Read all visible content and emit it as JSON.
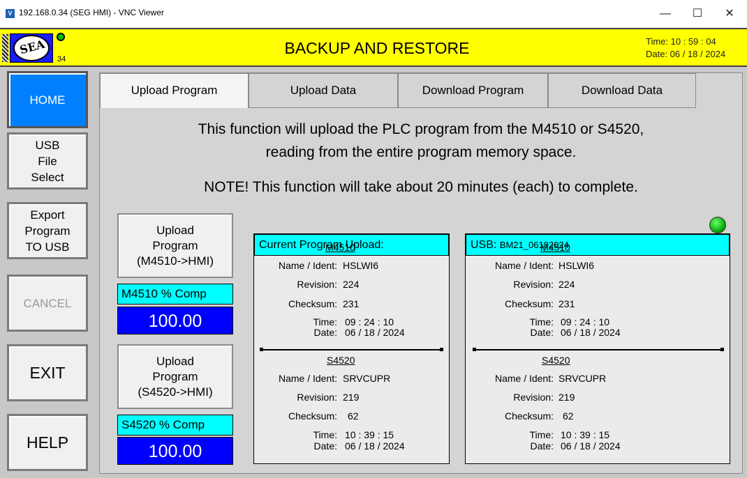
{
  "window": {
    "title": "192.168.0.34 (SEG HMI) - VNC Viewer",
    "logo_text": "V",
    "minimize": "—",
    "maximize": "☐",
    "close": "✕"
  },
  "header": {
    "logo_text": "SEA",
    "screen_number": "34",
    "title": "BACKUP AND RESTORE",
    "time": "Time: 10 : 59 : 04",
    "date": "Date: 06 / 18 / 2024"
  },
  "nav": {
    "home": "HOME",
    "usb_file_select": "USB\nFile\nSelect",
    "export_program": "Export\nProgram\nTO USB",
    "cancel": "CANCEL",
    "exit": "EXIT",
    "help": "HELP"
  },
  "tabs": [
    "Upload Program",
    "Upload Data",
    "Download Program",
    "Download Data"
  ],
  "description": {
    "line1": "This function will upload the PLC program from the M4510 or S4520,",
    "line2": "reading from the entire program memory space.",
    "note": "NOTE! This function will take about 20 minutes (each) to complete."
  },
  "upload": {
    "m4510_button": "Upload\nProgram\n(M4510->HMI)",
    "m4510_comp_label": "M4510 % Comp",
    "m4510_comp_value": "100.00",
    "s4520_button": "Upload\nProgram\n(S4520->HMI)",
    "s4520_comp_label": "S4520 % Comp",
    "s4520_comp_value": "100.00"
  },
  "current_panel": {
    "header": "Current Program Upload:",
    "m4510": {
      "title": "M4510",
      "name_label": "Name / Ident:",
      "name": "HSLWI6",
      "revision_label": "Revision:",
      "revision": "224",
      "checksum_label": "Checksum:",
      "checksum": "231",
      "time_label": "Time:",
      "time": "09 : 24 : 10",
      "date_label": "Date:",
      "date": "06 / 18 / 2024"
    },
    "s4520": {
      "title": "S4520",
      "name_label": "Name / Ident:",
      "name": "SRVCUPR",
      "revision_label": "Revision:",
      "revision": "219",
      "checksum_label": "Checksum:",
      "checksum": "62",
      "time_label": "Time:",
      "time": "10 : 39 : 15",
      "date_label": "Date:",
      "date": "06 / 18 / 2024"
    }
  },
  "usb_panel": {
    "header_prefix": "USB:",
    "file_name": "BM21_06182024",
    "status_color": "#00c000",
    "m4510": {
      "title": "M4510",
      "name_label": "Name / Ident:",
      "name": "HSLWI6",
      "revision_label": "Revision:",
      "revision": "224",
      "checksum_label": "Checksum:",
      "checksum": "231",
      "time_label": "Time:",
      "time": "09 : 24 : 10",
      "date_label": "Date:",
      "date": "06 / 18 / 2024"
    },
    "s4520": {
      "title": "S4520",
      "name_label": "Name / Ident:",
      "name": "SRVCUPR",
      "revision_label": "Revision:",
      "revision": "219",
      "checksum_label": "Checksum:",
      "checksum": "62",
      "time_label": "Time:",
      "time": "10 : 39 : 15",
      "date_label": "Date:",
      "date": "06 / 18 / 2024"
    }
  },
  "colors": {
    "header_yellow": "#ffff00",
    "home_blue": "#0080ff",
    "cyan": "#00ffff",
    "value_blue": "#0000ff"
  }
}
